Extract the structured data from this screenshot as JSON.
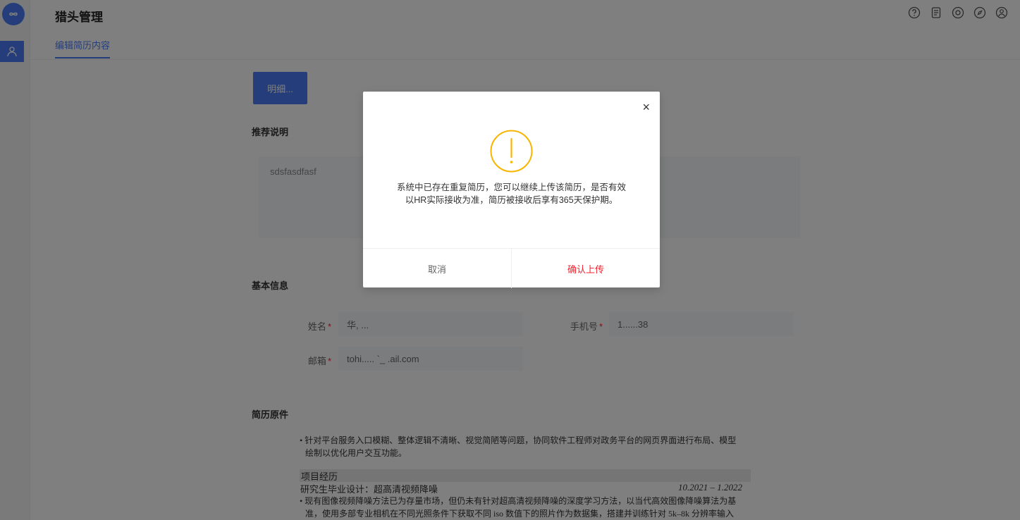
{
  "sidebar": {
    "logo_text": "∞",
    "items": [
      {
        "icon": "user-icon"
      }
    ]
  },
  "header": {
    "title": "猎头管理",
    "icons": [
      "help-icon",
      "document-icon",
      "support-icon",
      "compass-icon",
      "account-icon"
    ]
  },
  "tabs": [
    {
      "label": "编辑简历内容"
    }
  ],
  "upload_button": "明细...",
  "recommendation": {
    "title": "推荐说明",
    "text": "sdsfasdfasf"
  },
  "basic_info": {
    "title": "基本信息",
    "name_label": "姓名",
    "name_value": "华, ...",
    "phone_label": "手机号",
    "phone_value": "1‍......38",
    "email_label": "邮箱",
    "email_value": "tohi..... `_ .ail.com"
  },
  "attachment": {
    "title": "简历原件",
    "bullet1_line1": "• 针对平台服务入口模糊、整体逻辑不清晰、视觉简陋等问题，协同软件工程师对政务平台的网页界面进行布局、模型",
    "bullet1_line2": "绘制以优化用户交互功能。",
    "project_section": "项目经历",
    "project_title": "研究生毕业设计：超高清视频降噪",
    "project_date": "10.2021 – 1.2022",
    "bullet2_line1": "• 现有图像视频降噪方法已为存量市场，但仍未有针对超高清视频降噪的深度学习方法，以当代高效图像降噪算法为基",
    "bullet2_line2": "准，使用多部专业相机在不同光照条件下获取不同 iso 数值下的照片作为数据集，搭建并训练针对 5k–8k 分辨率输入"
  },
  "modal": {
    "close_label": "×",
    "message_line1": "系统中已存在重复简历，您可以继续上传该简历，是否有效",
    "message_line2": "以HR实际接收为准，简历被接收后享有365天保护期。",
    "cancel_label": "取消",
    "confirm_label": "确认上传",
    "warning_color": "#f7b500",
    "confirm_color": "#f5222d"
  }
}
